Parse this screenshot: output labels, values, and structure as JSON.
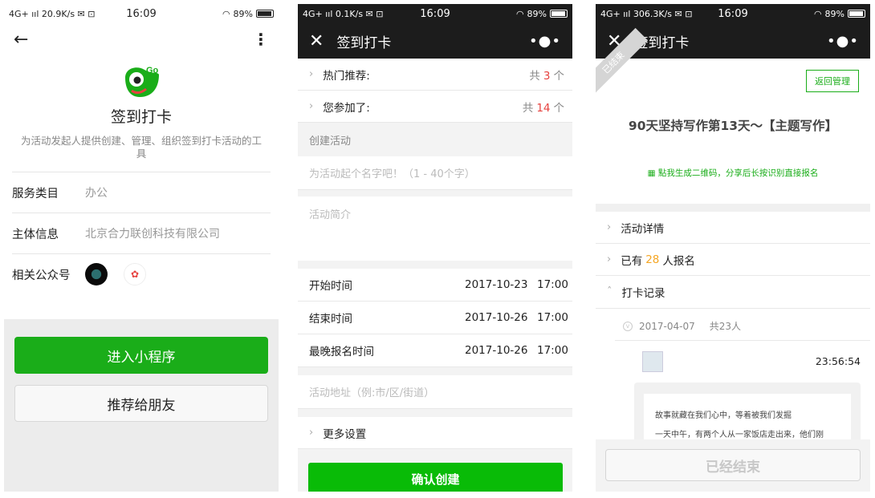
{
  "phone1": {
    "status": {
      "left": "4G+ ııl 20.9K/s ✉ ⊡",
      "time": "16:09",
      "battery": "89%"
    },
    "title": "签到打卡",
    "description": "为活动发起人提供创建、管理、组织签到打卡活动的工具",
    "rows": [
      {
        "key": "服务类目",
        "value": "办公"
      },
      {
        "key": "主体信息",
        "value": "北京合力联创科技有限公司"
      },
      {
        "key": "相关公众号",
        "value": ""
      }
    ],
    "enter_button": "进入小程序",
    "share_button": "推荐给朋友",
    "colors": {
      "accent": "#1aad19"
    }
  },
  "phone2": {
    "status": {
      "left": "4G+ ııl 0.1K/s ✉ ⊡",
      "time": "16:09",
      "battery": "89%"
    },
    "nav_title": "签到打卡",
    "list": [
      {
        "label": "热门推荐:",
        "prefix": "共",
        "count": "3",
        "suffix": "个"
      },
      {
        "label": "您参加了:",
        "prefix": "共",
        "count": "14",
        "suffix": "个"
      }
    ],
    "section_create": "创建活动",
    "name_placeholder": "为活动起个名字吧！（1 - 40个字）",
    "intro_placeholder": "活动简介",
    "times": [
      {
        "label": "开始时间",
        "date": "2017-10-23",
        "time": "17:00"
      },
      {
        "label": "结束时间",
        "date": "2017-10-26",
        "time": "17:00"
      },
      {
        "label": "最晚报名时间",
        "date": "2017-10-26",
        "time": "17:00"
      }
    ],
    "address_placeholder": "活动地址（例:市/区/街道）",
    "more_settings": "更多设置",
    "confirm_button": "确认创建"
  },
  "phone3": {
    "status": {
      "left": "4G+ ııl 306.3K/s ✉ ⊡",
      "time": "16:09",
      "battery": "89%"
    },
    "nav_title": "签到打卡",
    "ribbon": "已结束",
    "back_button": "返回管理",
    "heading": "90天坚持写作第13天～【主题写作】",
    "qr_hint": "點我生成二维码，分享后长按识别直接报名",
    "detail_item": "活动详情",
    "signup_prefix": "已有",
    "signup_count": "28",
    "signup_suffix": "人报名",
    "record_item": "打卡记录",
    "record_date": "2017-04-07",
    "record_total": "共23人",
    "record_time": "23:56:54",
    "note_lines": [
      "故事就藏在我们心中，等着被我们发掘",
      "一天中午，有两个人从一家饭店走出来，他们刚"
    ],
    "ended_button": "已经结束"
  }
}
